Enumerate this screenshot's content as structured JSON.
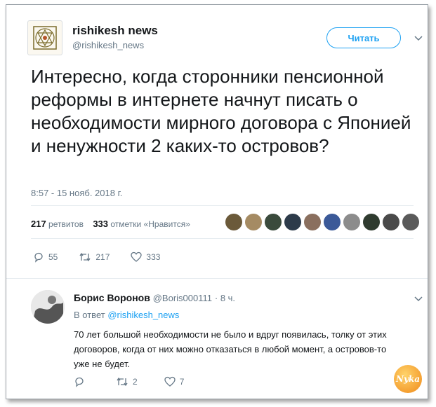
{
  "tweet": {
    "author_name": "rishikesh news",
    "author_handle": "@rishikesh_news",
    "follow_label": "Читать",
    "text": "Интересно, когда сторонники пенсионной реформы в интернете начнут писать о необходимости мирного договора с Японией и ненужности 2 каких-то островов?",
    "timestamp": "8:57 - 15 нояб. 2018 г.",
    "retweets_count": "217",
    "retweets_label": "ретвитов",
    "likes_count": "333",
    "likes_label": "отметки «Нравится»",
    "actions": {
      "reply_count": "55",
      "retweet_count": "217",
      "like_count": "333"
    },
    "liker_avatar_colors": [
      "#6b5a3a",
      "#a58b63",
      "#3a4a3c",
      "#2d3b4a",
      "#8a6f5e",
      "#3b5998",
      "#8c8c8c",
      "#2f3b2f",
      "#4a4a4a",
      "#5a5a5a"
    ]
  },
  "reply": {
    "author_name": "Борис Воронов",
    "author_handle": "@Boris000111",
    "time": "· 8 ч.",
    "in_reply_prefix": "В ответ",
    "in_reply_handle": "@rishikesh_news",
    "text": "70 лет большой необходимости не было и вдруг появилась, толку от этих договоров, когда от них можно отказаться в любой момент, а островов-то уже не будет.",
    "actions": {
      "reply_count": "",
      "retweet_count": "2",
      "like_count": "7"
    }
  },
  "watermark_text": "Nyka",
  "colors": {
    "accent": "#1da1f2",
    "muted": "#657786",
    "text": "#14171a",
    "divider": "#e6ecf0"
  }
}
